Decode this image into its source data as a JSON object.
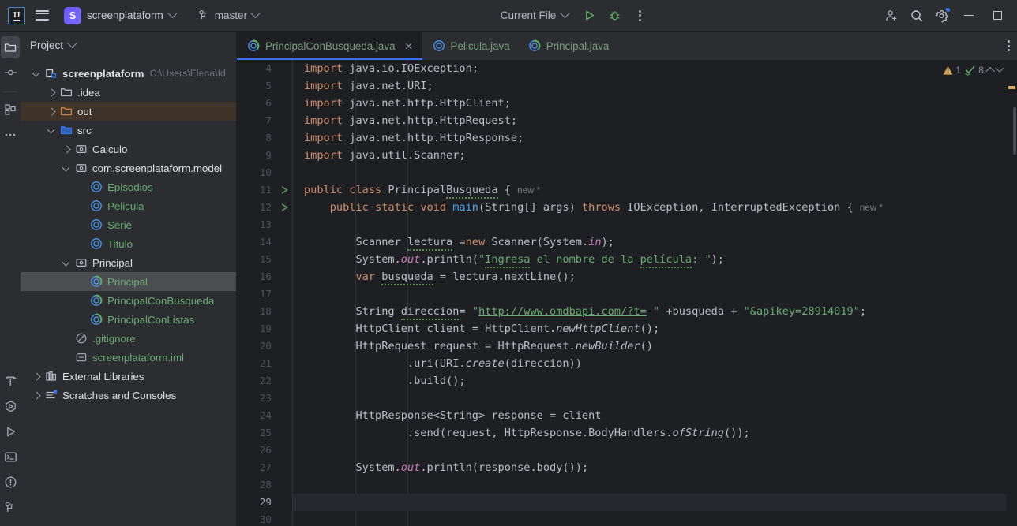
{
  "titlebar": {
    "logo_text": "IJ",
    "project_badge": "S",
    "project_name": "screenplataform",
    "branch": "master",
    "run_config": "Current File",
    "menu_icon": "hamburger-menu-icon",
    "vcs_icon": "git-branch-icon",
    "run_icon": "run-icon",
    "debug_icon": "debug-icon",
    "more_icon": "more-vertical-icon",
    "account_icon": "account-add-icon",
    "search_icon": "search-icon",
    "settings_icon": "gear-icon",
    "minimize_icon": "minimize-icon",
    "maximize_icon": "maximize-icon"
  },
  "rail": {
    "top": [
      {
        "name": "project",
        "icon": "folder-icon",
        "active": true
      },
      {
        "name": "commit",
        "icon": "commit-icon",
        "active": false
      },
      {
        "name": "structure",
        "icon": "four-squares-icon",
        "active": false
      },
      {
        "name": "more-tools",
        "icon": "more-horizontal-icon",
        "active": false
      }
    ],
    "bottom": [
      {
        "name": "build",
        "icon": "hammer-icon"
      },
      {
        "name": "services",
        "icon": "services-icon"
      },
      {
        "name": "run",
        "icon": "play-icon"
      },
      {
        "name": "terminal",
        "icon": "terminal-icon"
      },
      {
        "name": "problems",
        "icon": "warning-circle-icon"
      },
      {
        "name": "version-control",
        "icon": "git-branch-icon"
      }
    ]
  },
  "project_panel": {
    "title": "Project",
    "tree": [
      {
        "label": "screenplataform",
        "path": "C:\\Users\\Elena\\Id",
        "indent": 0,
        "arrow": "down",
        "icon": "module-icon",
        "style": "bold",
        "state": "normal"
      },
      {
        "label": ".idea",
        "path": "",
        "indent": 1,
        "arrow": "right",
        "icon": "folder-gray-icon",
        "style": "white",
        "state": "normal"
      },
      {
        "label": "out",
        "path": "",
        "indent": 1,
        "arrow": "right",
        "icon": "folder-orange-icon",
        "style": "white",
        "state": "excluded"
      },
      {
        "label": "src",
        "path": "",
        "indent": 1,
        "arrow": "down",
        "icon": "folder-blue-icon",
        "style": "white",
        "state": "normal"
      },
      {
        "label": "Calculo",
        "path": "",
        "indent": 2,
        "arrow": "right",
        "icon": "package-icon",
        "style": "white",
        "state": "normal"
      },
      {
        "label": "com.screenplataform.model",
        "path": "",
        "indent": 2,
        "arrow": "down",
        "icon": "package-icon",
        "style": "white",
        "state": "normal"
      },
      {
        "label": "Episodios",
        "path": "",
        "indent": 3,
        "arrow": "none",
        "icon": "class-icon",
        "style": "green",
        "state": "normal"
      },
      {
        "label": "Pelicula",
        "path": "",
        "indent": 3,
        "arrow": "none",
        "icon": "class-icon",
        "style": "green",
        "state": "normal"
      },
      {
        "label": "Serie",
        "path": "",
        "indent": 3,
        "arrow": "none",
        "icon": "class-icon",
        "style": "green",
        "state": "normal"
      },
      {
        "label": "Titulo",
        "path": "",
        "indent": 3,
        "arrow": "none",
        "icon": "class-icon",
        "style": "green",
        "state": "normal"
      },
      {
        "label": "Principal",
        "path": "",
        "indent": 2,
        "arrow": "down",
        "icon": "package-icon",
        "style": "white",
        "state": "normal"
      },
      {
        "label": "Principal",
        "path": "",
        "indent": 3,
        "arrow": "none",
        "icon": "runnable-class-icon",
        "style": "green",
        "state": "selected"
      },
      {
        "label": "PrincipalConBusqueda",
        "path": "",
        "indent": 3,
        "arrow": "none",
        "icon": "runnable-class-icon",
        "style": "green",
        "state": "normal"
      },
      {
        "label": "PrincipalConListas",
        "path": "",
        "indent": 3,
        "arrow": "none",
        "icon": "runnable-class-icon",
        "style": "green",
        "state": "normal"
      },
      {
        "label": ".gitignore",
        "path": "",
        "indent": 2,
        "arrow": "none",
        "icon": "gitignore-icon",
        "style": "green",
        "state": "normal"
      },
      {
        "label": "screenplataform.iml",
        "path": "",
        "indent": 2,
        "arrow": "none",
        "icon": "iml-icon",
        "style": "green",
        "state": "normal"
      },
      {
        "label": "External Libraries",
        "path": "",
        "indent": 0,
        "arrow": "right",
        "icon": "libraries-icon",
        "style": "white",
        "state": "normal"
      },
      {
        "label": "Scratches and Consoles",
        "path": "",
        "indent": 0,
        "arrow": "right",
        "icon": "scratches-icon",
        "style": "white",
        "state": "normal"
      }
    ]
  },
  "tabs": [
    {
      "label": "PrincipalConBusqueda.java",
      "icon": "runnable-class-icon",
      "active": true,
      "closable": true
    },
    {
      "label": "Pelicula.java",
      "icon": "class-icon",
      "active": false,
      "closable": false
    },
    {
      "label": "Principal.java",
      "icon": "runnable-class-icon",
      "active": false,
      "closable": false
    }
  ],
  "tabbar": {
    "options_icon": "more-vertical-icon"
  },
  "inspections": {
    "warning_count": "1",
    "check_count": "8",
    "warning_icon": "warning-triangle-icon",
    "check_icon": "inspection-check-icon",
    "up_icon": "chevron-up-icon",
    "down_icon": "chevron-down-icon"
  },
  "editor": {
    "first_line": 4,
    "caret_line": 29,
    "run_gutter_lines": [
      11,
      12
    ],
    "lines": [
      {
        "n": 4,
        "tokens": [
          {
            "t": "import ",
            "c": "kw"
          },
          {
            "t": "java.io.IOException;",
            "c": ""
          }
        ],
        "indent": 0
      },
      {
        "n": 5,
        "tokens": [
          {
            "t": "import ",
            "c": "kw"
          },
          {
            "t": "java.net.URI;",
            "c": ""
          }
        ],
        "indent": 0
      },
      {
        "n": 6,
        "tokens": [
          {
            "t": "import ",
            "c": "kw"
          },
          {
            "t": "java.net.http.HttpClient;",
            "c": ""
          }
        ],
        "indent": 0
      },
      {
        "n": 7,
        "tokens": [
          {
            "t": "import ",
            "c": "kw"
          },
          {
            "t": "java.net.http.HttpRequest;",
            "c": ""
          }
        ],
        "indent": 0
      },
      {
        "n": 8,
        "tokens": [
          {
            "t": "import ",
            "c": "kw"
          },
          {
            "t": "java.net.http.HttpResponse;",
            "c": ""
          }
        ],
        "indent": 0
      },
      {
        "n": 9,
        "tokens": [
          {
            "t": "import ",
            "c": "kw"
          },
          {
            "t": "java.util.Scanner;",
            "c": ""
          }
        ],
        "indent": 0
      },
      {
        "n": 10,
        "tokens": [],
        "indent": 0
      },
      {
        "n": 11,
        "tokens": [
          {
            "t": "public class ",
            "c": "kw"
          },
          {
            "t": "Principal",
            "c": ""
          },
          {
            "t": "Busqueda",
            "c": "typo"
          },
          {
            "t": " { ",
            "c": ""
          },
          {
            "t": "new *",
            "c": "hint"
          }
        ],
        "indent": 0
      },
      {
        "n": 12,
        "tokens": [
          {
            "t": "    ",
            "c": ""
          },
          {
            "t": "public static void ",
            "c": "kw"
          },
          {
            "t": "main",
            "c": "mth"
          },
          {
            "t": "(String[] args) ",
            "c": ""
          },
          {
            "t": "throws ",
            "c": "kw"
          },
          {
            "t": "IOException, InterruptedException { ",
            "c": ""
          },
          {
            "t": "new *",
            "c": "hint"
          }
        ],
        "indent": 0
      },
      {
        "n": 13,
        "tokens": [],
        "indent": 1
      },
      {
        "n": 14,
        "tokens": [
          {
            "t": "        Scanner ",
            "c": ""
          },
          {
            "t": "lectura",
            "c": "typo"
          },
          {
            "t": " =",
            "c": ""
          },
          {
            "t": "new ",
            "c": "kw"
          },
          {
            "t": "Scanner(System.",
            "c": ""
          },
          {
            "t": "in",
            "c": "fld"
          },
          {
            "t": ");",
            "c": ""
          }
        ],
        "indent": 1
      },
      {
        "n": 15,
        "tokens": [
          {
            "t": "        System.",
            "c": ""
          },
          {
            "t": "out",
            "c": "fld"
          },
          {
            "t": ".println(",
            "c": ""
          },
          {
            "t": "\"",
            "c": "str"
          },
          {
            "t": "Ingresa",
            "c": "str typo"
          },
          {
            "t": " el nombre de la ",
            "c": "str"
          },
          {
            "t": "película",
            "c": "str typo"
          },
          {
            "t": ": \"",
            "c": "str"
          },
          {
            "t": ");",
            "c": ""
          }
        ],
        "indent": 1
      },
      {
        "n": 16,
        "tokens": [
          {
            "t": "        ",
            "c": ""
          },
          {
            "t": "var ",
            "c": "kw"
          },
          {
            "t": "busqueda",
            "c": "typo"
          },
          {
            "t": " = lectura.nextLine();",
            "c": ""
          }
        ],
        "indent": 1
      },
      {
        "n": 17,
        "tokens": [],
        "indent": 1
      },
      {
        "n": 18,
        "tokens": [
          {
            "t": "        String ",
            "c": ""
          },
          {
            "t": "direccion",
            "c": "typo"
          },
          {
            "t": "= ",
            "c": ""
          },
          {
            "t": "\"",
            "c": "str"
          },
          {
            "t": "http://www.omdbapi.com/?t=",
            "c": "str link"
          },
          {
            "t": " \"",
            "c": "str"
          },
          {
            "t": " +busqueda + ",
            "c": ""
          },
          {
            "t": "\"&apikey=28914019\"",
            "c": "str"
          },
          {
            "t": ";",
            "c": ""
          }
        ],
        "indent": 1
      },
      {
        "n": 19,
        "tokens": [
          {
            "t": "        HttpClient client = HttpClient.",
            "c": ""
          },
          {
            "t": "newHttpClient",
            "c": "stm"
          },
          {
            "t": "();",
            "c": ""
          }
        ],
        "indent": 1
      },
      {
        "n": 20,
        "tokens": [
          {
            "t": "        HttpRequest request = HttpRequest.",
            "c": ""
          },
          {
            "t": "newBuilder",
            "c": "stm"
          },
          {
            "t": "()",
            "c": ""
          }
        ],
        "indent": 1
      },
      {
        "n": 21,
        "tokens": [
          {
            "t": "                .uri(URI.",
            "c": ""
          },
          {
            "t": "create",
            "c": "stm"
          },
          {
            "t": "(direccion))",
            "c": ""
          }
        ],
        "indent": 2
      },
      {
        "n": 22,
        "tokens": [
          {
            "t": "                .build();",
            "c": ""
          }
        ],
        "indent": 2
      },
      {
        "n": 23,
        "tokens": [],
        "indent": 1
      },
      {
        "n": 24,
        "tokens": [
          {
            "t": "        HttpResponse<String> response = client",
            "c": ""
          }
        ],
        "indent": 1
      },
      {
        "n": 25,
        "tokens": [
          {
            "t": "                .send(request, HttpResponse.BodyHandlers.",
            "c": ""
          },
          {
            "t": "ofString",
            "c": "stm"
          },
          {
            "t": "());",
            "c": ""
          }
        ],
        "indent": 2
      },
      {
        "n": 26,
        "tokens": [],
        "indent": 1
      },
      {
        "n": 27,
        "tokens": [
          {
            "t": "        System.",
            "c": ""
          },
          {
            "t": "out",
            "c": "fld"
          },
          {
            "t": ".println(response.body());",
            "c": ""
          }
        ],
        "indent": 1
      },
      {
        "n": 28,
        "tokens": [],
        "indent": 1
      },
      {
        "n": 29,
        "tokens": [],
        "indent": 1
      },
      {
        "n": 30,
        "tokens": [],
        "indent": 1
      }
    ]
  }
}
